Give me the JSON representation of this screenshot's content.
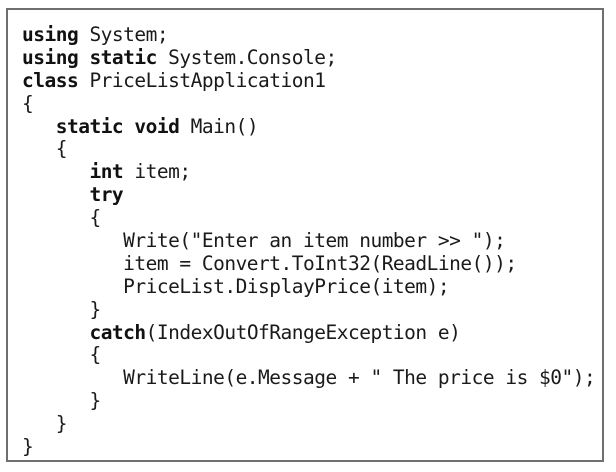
{
  "code_listing": {
    "lines": [
      {
        "indent": "",
        "keyword": "using",
        "text": " System;"
      },
      {
        "indent": "",
        "keyword": "using static",
        "text": " System.Console;"
      },
      {
        "indent": "",
        "keyword": "class",
        "text": " PriceListApplication1"
      },
      {
        "indent": "",
        "keyword": "",
        "text": "{"
      },
      {
        "indent": "   ",
        "keyword": "static void",
        "text": " Main()"
      },
      {
        "indent": "   ",
        "keyword": "",
        "text": "{"
      },
      {
        "indent": "      ",
        "keyword": "int",
        "text": " item;"
      },
      {
        "indent": "      ",
        "keyword": "try",
        "text": ""
      },
      {
        "indent": "      ",
        "keyword": "",
        "text": "{"
      },
      {
        "indent": "         ",
        "keyword": "",
        "text": "Write(\"Enter an item number >> \");"
      },
      {
        "indent": "         ",
        "keyword": "",
        "text": "item = Convert.ToInt32(ReadLine());"
      },
      {
        "indent": "         ",
        "keyword": "",
        "text": "PriceList.DisplayPrice(item);"
      },
      {
        "indent": "      ",
        "keyword": "",
        "text": "}"
      },
      {
        "indent": "      ",
        "keyword": "catch",
        "text": "(IndexOutOfRangeException e)"
      },
      {
        "indent": "      ",
        "keyword": "",
        "text": "{"
      },
      {
        "indent": "         ",
        "keyword": "",
        "text": "WriteLine(e.Message + \" The price is $0\");"
      },
      {
        "indent": "      ",
        "keyword": "",
        "text": "}"
      },
      {
        "indent": "   ",
        "keyword": "",
        "text": "}"
      },
      {
        "indent": "",
        "keyword": "",
        "text": "}"
      }
    ]
  }
}
